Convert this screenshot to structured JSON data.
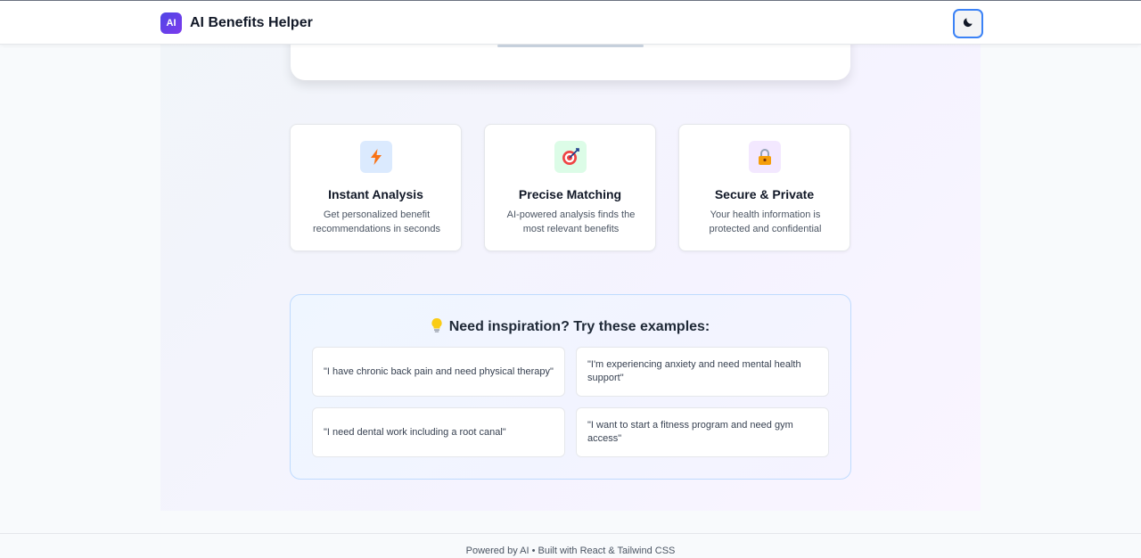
{
  "header": {
    "logo_text": "AI",
    "title": "AI Benefits Helper",
    "theme_toggle_icon": "moon-icon"
  },
  "features": [
    {
      "icon": "lightning-icon",
      "icon_bg": "#dbeafe",
      "title": "Instant Analysis",
      "description": "Get personalized benefit recommendations in seconds"
    },
    {
      "icon": "target-icon",
      "icon_bg": "#dcfce7",
      "title": "Precise Matching",
      "description": "AI-powered analysis finds the most relevant benefits"
    },
    {
      "icon": "lock-icon",
      "icon_bg": "#f3e8ff",
      "title": "Secure & Private",
      "description": "Your health information is protected and confidential"
    }
  ],
  "examples": {
    "heading": "Need inspiration? Try these examples:",
    "items": [
      "\"I have chronic back pain and need physical therapy\"",
      "\"I'm experiencing anxiety and need mental health support\"",
      "\"I need dental work including a root canal\"",
      "\"I want to start a fitness program and need gym access\""
    ]
  },
  "footer": {
    "text": "Powered by AI • Built with React & Tailwind CSS"
  },
  "colors": {
    "brand_gradient_start": "#4f46e5",
    "brand_gradient_end": "#7c3aed",
    "toggle_border": "#3b82f6"
  }
}
